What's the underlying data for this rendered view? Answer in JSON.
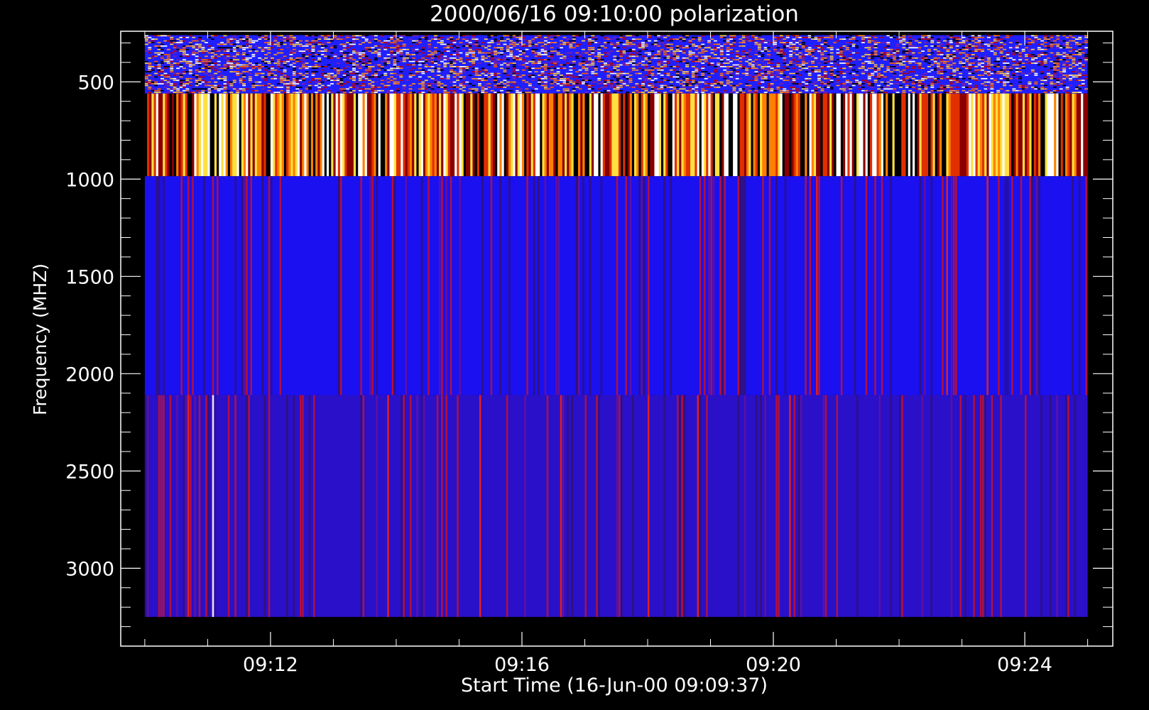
{
  "chart_data": {
    "type": "heatmap",
    "title": "2000/06/16 09:10:00 polarization",
    "xlabel": "Start Time (16-Jun-00 09:09:37)",
    "ylabel": "Frequency (MHZ)",
    "x_ticks": [
      "09:12",
      "09:16",
      "09:20",
      "09:24"
    ],
    "x_tick_values_minutes": [
      12,
      16,
      20,
      24
    ],
    "xlim_minutes": [
      9.617,
      25.4
    ],
    "data_xlim_minutes": [
      10.0,
      25.0
    ],
    "y_ticks": [
      500,
      1000,
      1500,
      2000,
      2500,
      3000
    ],
    "ylim": [
      3400,
      240
    ],
    "data_ylim": [
      3250,
      260
    ],
    "inverted_y": true,
    "bands": [
      {
        "from_mhz": 260,
        "to_mhz": 560,
        "pattern": "noisy-speckle",
        "dominant": "#2020ff"
      },
      {
        "from_mhz": 560,
        "to_mhz": 985,
        "pattern": "vertical-stripes",
        "palette": [
          "#000000",
          "#8a0000",
          "#e03000",
          "#ff8000",
          "#ffe040",
          "#ffffff"
        ]
      },
      {
        "from_mhz": 985,
        "to_mhz": 2110,
        "pattern": "vertical-stripes",
        "dominant": "#1a10f0"
      },
      {
        "from_mhz": 2110,
        "to_mhz": 3250,
        "pattern": "vertical-stripes",
        "dominant": "#2a10c8"
      }
    ],
    "colors": {
      "background": "#000000",
      "axes": "#ffffff"
    },
    "grid": false,
    "legend": "none"
  }
}
